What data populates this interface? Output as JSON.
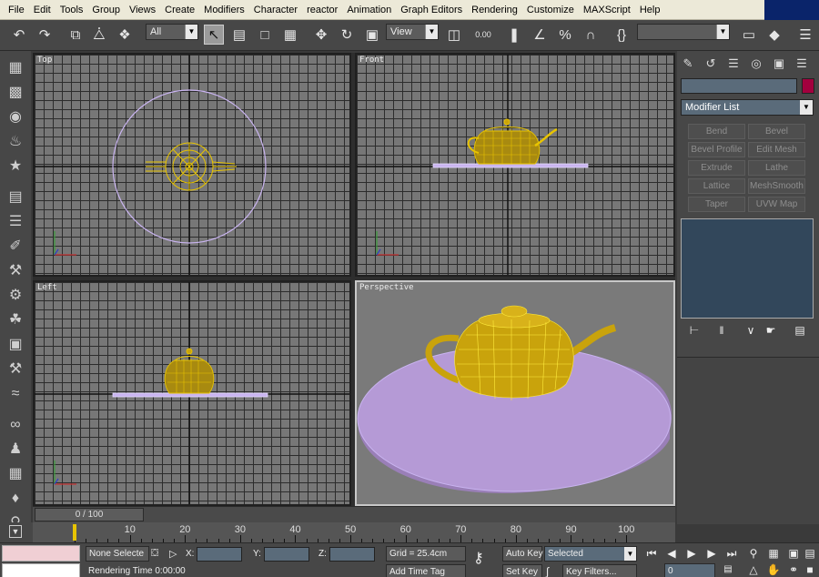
{
  "menu": [
    "File",
    "Edit",
    "Tools",
    "Group",
    "Views",
    "Create",
    "Modifiers",
    "Character",
    "reactor",
    "Animation",
    "Graph Editors",
    "Rendering",
    "Customize",
    "MAXScript",
    "Help"
  ],
  "toolbar": {
    "undo_icon": "undo-icon",
    "redo_icon": "redo-icon",
    "selection_filter": "All",
    "ref_coord": "View",
    "spinner_snap": "0.00",
    "named_selection": ""
  },
  "viewports": {
    "top": {
      "label": "Top"
    },
    "front": {
      "label": "Front"
    },
    "left": {
      "label": "Left"
    },
    "perspective": {
      "label": "Perspective"
    }
  },
  "command_panel": {
    "object_name": "",
    "object_color": "#a3003e",
    "modifier_list": "Modifier List",
    "modifier_buttons": [
      "Bend",
      "Bevel",
      "Bevel Profile",
      "Edit Mesh",
      "Extrude",
      "Lathe",
      "Lattice",
      "MeshSmooth",
      "Taper",
      "UVW Map"
    ]
  },
  "timeline": {
    "frame_slider": "0 / 100",
    "ruler_labels": [
      "10",
      "20",
      "30",
      "40",
      "50",
      "60",
      "70",
      "80",
      "90",
      "100"
    ]
  },
  "status": {
    "selection": "None Selecte",
    "x_label": "X:",
    "y_label": "Y:",
    "z_label": "Z:",
    "grid": "Grid = 25.4cm",
    "rendering_time": "Rendering Time  0:00:00",
    "add_time_tag": "Add Time Tag",
    "auto_key": "Auto Key",
    "set_key": "Set Key",
    "key_mode": "Selected",
    "key_filters": "Key Filters...",
    "current_frame": "0"
  },
  "colors": {
    "teapot_wire": "#e8c400",
    "teapot_fill": "#c9a30c",
    "plane": "#b59ad6",
    "plane_wire": "#c9b4f0"
  }
}
